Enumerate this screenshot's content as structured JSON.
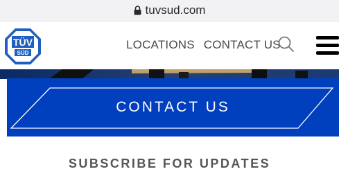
{
  "browser": {
    "url": "tuvsud.com"
  },
  "header": {
    "logo_text_top": "TÜV",
    "logo_text_bottom": "SÜD",
    "nav_items": [
      "LOCATIONS",
      "CONTACT US"
    ],
    "icons": [
      "search-icon",
      "hamburger-menu-icon"
    ]
  },
  "cta": {
    "label": "CONTACT US"
  },
  "section": {
    "subscribe_title": "SUBSCRIBE FOR UPDATES"
  },
  "colors": {
    "brand_blue": "#003fbe",
    "logo_blue": "#1f5fbf"
  }
}
